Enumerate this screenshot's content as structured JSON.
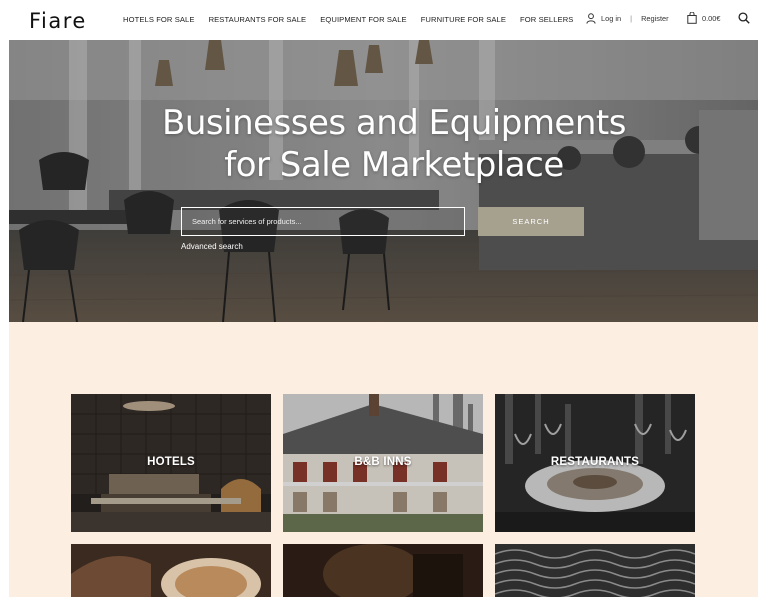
{
  "header": {
    "logo": "Fiare",
    "nav": [
      "HOTELS FOR SALE",
      "RESTAURANTS FOR SALE",
      "EQUIPMENT FOR SALE",
      "FURNITURE FOR SALE",
      "FOR SELLERS"
    ],
    "login": "Log in",
    "separator": "|",
    "register": "Register",
    "cart_total": "0.00€",
    "icons": [
      "user-icon",
      "bag-icon",
      "search-icon"
    ]
  },
  "hero": {
    "title_line1": "Businesses and Equipments",
    "title_line2": "for Sale Marketplace",
    "search_placeholder": "Search for services of products...",
    "search_button": "SEARCH",
    "advanced_link": "Advanced search"
  },
  "categories": [
    {
      "label": "HOTELS"
    },
    {
      "label": "B&B INNS"
    },
    {
      "label": "RESTAURANTS"
    }
  ],
  "colors": {
    "section_bg": "#fdeee2",
    "search_button_bg": "#a6a18f"
  }
}
